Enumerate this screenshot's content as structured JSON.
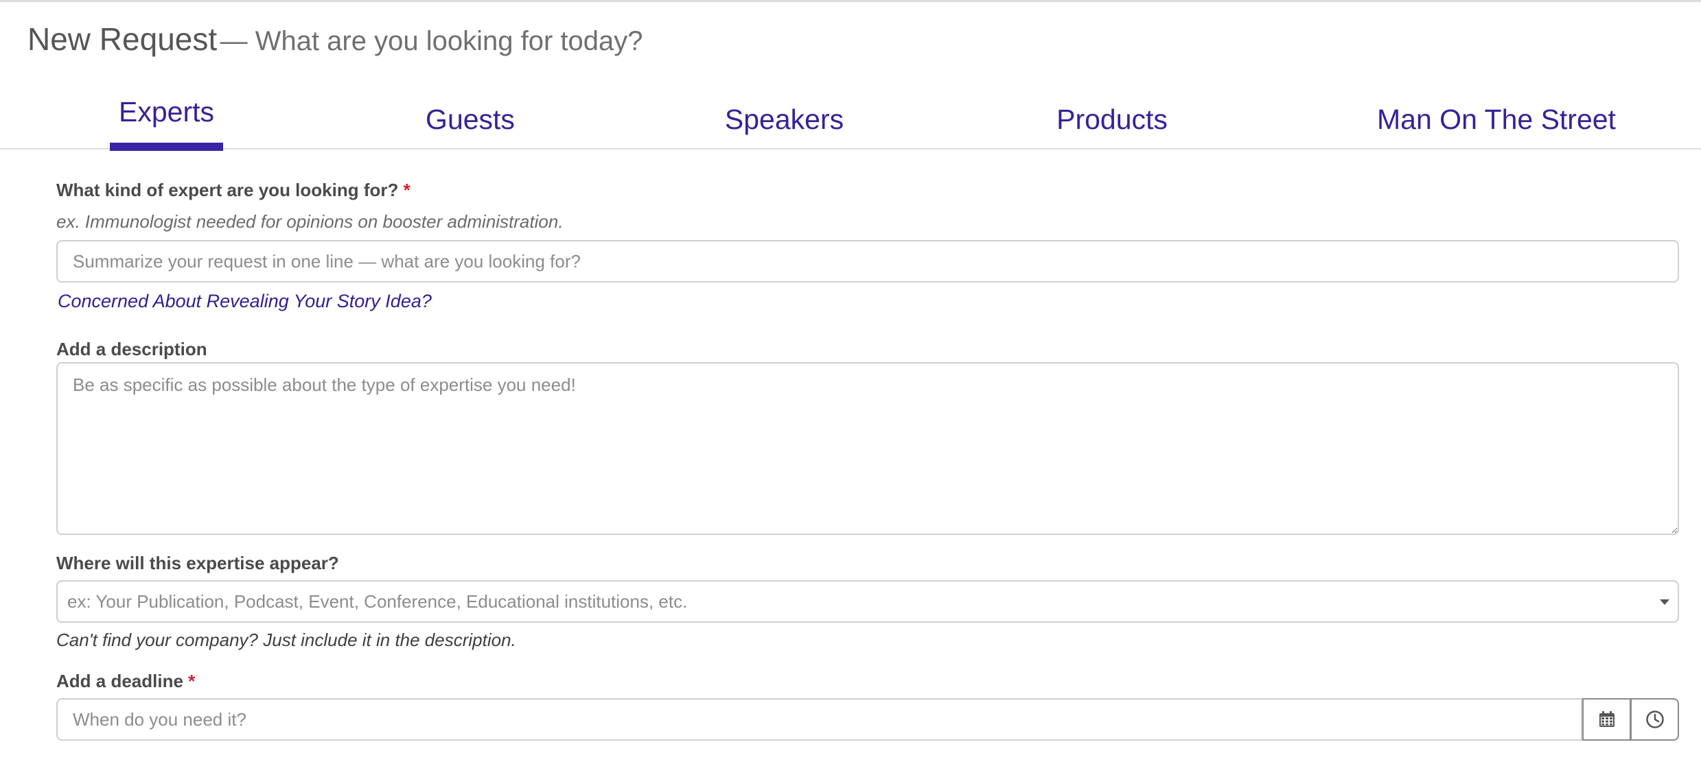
{
  "header": {
    "title": "New Request",
    "subtitle": "— What are you looking for today?"
  },
  "tabs": [
    {
      "label": "Experts",
      "active": true
    },
    {
      "label": "Guests",
      "active": false
    },
    {
      "label": "Speakers",
      "active": false
    },
    {
      "label": "Products",
      "active": false
    },
    {
      "label": "Man On The Street",
      "active": false
    }
  ],
  "form": {
    "expert_kind": {
      "label": "What kind of expert are you looking for?",
      "required_mark": "*",
      "example": "ex. Immunologist needed for opinions on booster administration.",
      "placeholder": "Summarize your request in one line — what are you looking for?",
      "value": ""
    },
    "story_idea_link": "Concerned About Revealing Your Story Idea?",
    "description": {
      "label": "Add a description",
      "placeholder": "Be as specific as possible about the type of expertise you need!",
      "value": ""
    },
    "appear": {
      "label": "Where will this expertise appear?",
      "placeholder": "ex: Your Publication, Podcast, Event, Conference, Educational institutions, etc.",
      "hint": "Can't find your company? Just include it in the description."
    },
    "deadline": {
      "label": "Add a deadline",
      "required_mark": "*",
      "placeholder": "When do you need it?",
      "value": "",
      "calendar_icon": "calendar-icon",
      "clock_icon": "clock-icon"
    }
  },
  "colors": {
    "accent": "#3a24a6",
    "tab_text": "#35229a",
    "required": "#d0202e",
    "border": "#cfcfcf"
  }
}
